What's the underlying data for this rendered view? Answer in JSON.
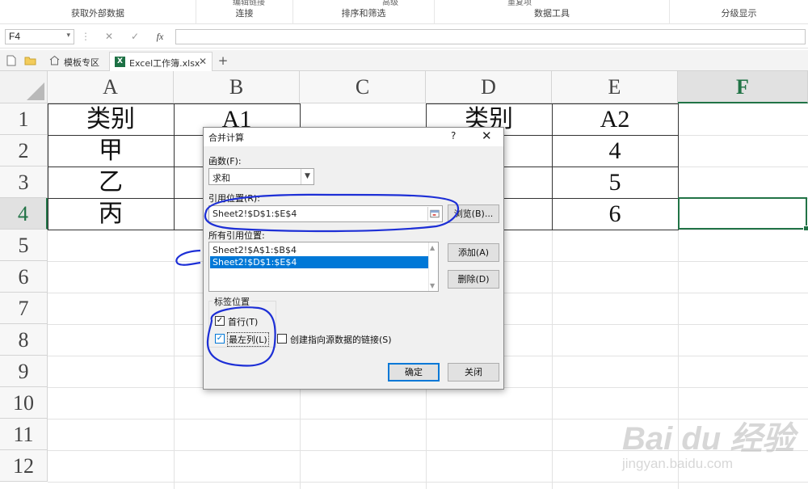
{
  "ribbon": {
    "groups": [
      "获取外部数据",
      "连接",
      "排序和筛选",
      "数据工具",
      "分级显示"
    ],
    "partial_top": [
      "编辑链接",
      "高级",
      "重复项",
      "..."
    ]
  },
  "formula_bar": {
    "name_box": "F4",
    "cancel_icon": "✕",
    "enter_icon": "✓",
    "fx_label": "fx",
    "formula": ""
  },
  "tabs": {
    "template_tab": "模板专区",
    "file_tab": "Excel工作簿.xlsx",
    "add_label": "+"
  },
  "sheet": {
    "columns": [
      "A",
      "B",
      "C",
      "D",
      "E",
      "F"
    ],
    "selected_column": "F",
    "rows": [
      "1",
      "2",
      "3",
      "4",
      "5",
      "6",
      "7",
      "8",
      "9",
      "10",
      "11",
      "12"
    ],
    "selected_row": "4",
    "cells": {
      "A1": "类别",
      "A2": "甲",
      "A3": "乙",
      "A4": "丙",
      "B1": "A1",
      "D1": "类别",
      "E1": "A2",
      "E2": "4",
      "E3": "5",
      "E4": "6"
    }
  },
  "dialog": {
    "title": "合并计算",
    "help": "?",
    "close": "✕",
    "function_label": "函数(F):",
    "function_value": "求和",
    "reference_label": "引用位置(R):",
    "reference_value": "Sheet2!$D$1:$E$4",
    "browse_button": "浏览(B)...",
    "all_refs_label": "所有引用位置:",
    "all_refs": [
      "Sheet2!$A$1:$B$4",
      "Sheet2!$D$1:$E$4"
    ],
    "selected_ref_index": 1,
    "add_button": "添加(A)",
    "delete_button": "删除(D)",
    "labels_group": "标签位置",
    "top_row": "首行(T)",
    "top_row_checked": true,
    "left_column": "最左列(L)",
    "left_column_checked": true,
    "create_links": "创建指向源数据的链接(S)",
    "create_links_checked": false,
    "ok_button": "确定",
    "close_button": "关闭"
  },
  "watermark": {
    "logo_text": "Bai du 经验",
    "site": "jingyan.baidu.com"
  },
  "colors": {
    "excel_green": "#217346",
    "selection_blue": "#0078d7",
    "annotation_blue": "#1d2fd6"
  }
}
